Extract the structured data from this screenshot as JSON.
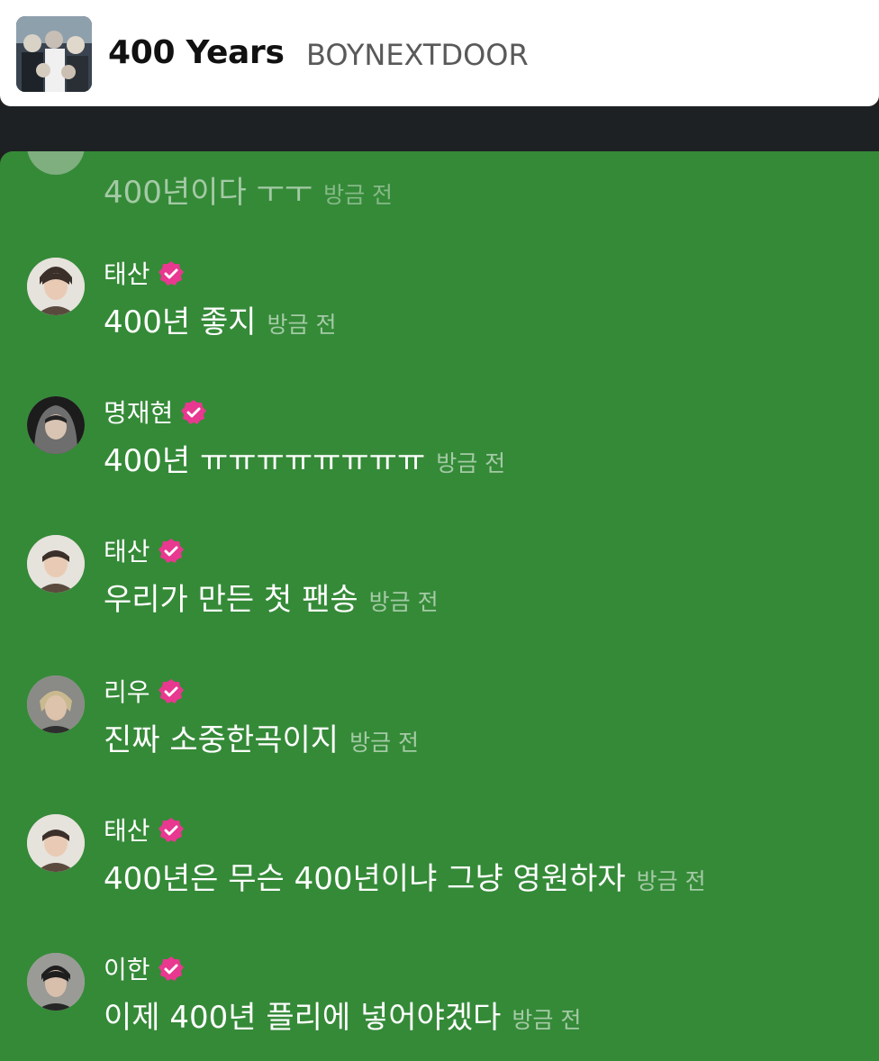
{
  "header": {
    "track_title": "400 Years",
    "artist": "BOYNEXTDOOR"
  },
  "messages": [
    {
      "text": "400년이다 ㅜㅜ",
      "time": "방금 전"
    },
    {
      "user": "태산",
      "text": "400년 좋지",
      "time": "방금 전"
    },
    {
      "user": "명재현",
      "text": "400년 ㅠㅠㅠㅠㅠㅠㅠㅠ",
      "time": "방금 전"
    },
    {
      "user": "태산",
      "text": "우리가 만든 첫 팬송",
      "time": "방금 전"
    },
    {
      "user": "리우",
      "text": "진짜 소중한곡이지",
      "time": "방금 전"
    },
    {
      "user": "태산",
      "text": "400년은 무슨 400년이냐 그냥 영원하자",
      "time": "방금 전"
    },
    {
      "user": "이한",
      "text": "이제 400년 플리에 넣어야겠다",
      "time": "방금 전"
    }
  ],
  "colors": {
    "chat_bg": "#358a38",
    "verified_badge": "#e8388f",
    "header_bg": "#ffffff"
  }
}
